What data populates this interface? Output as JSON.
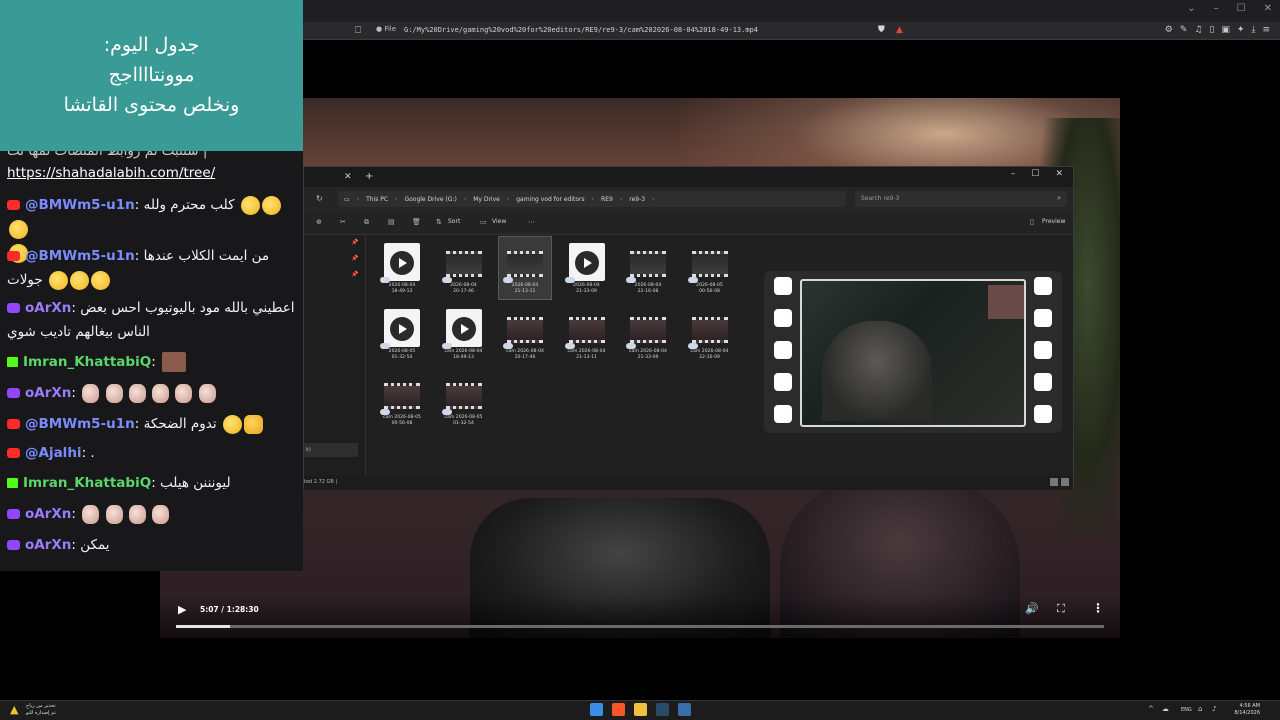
{
  "browser": {
    "window_controls": [
      "⌄",
      "–",
      "☐",
      "✕"
    ],
    "file_label": "File",
    "url": "G:/My%20Drive/gaming%20vod%20for%20editors/RE9/re9-3/cam%202026-08-04%2018-49-13.mp4"
  },
  "schedule": {
    "lines": [
      "جدول اليوم:",
      "موونتااااجج",
      "ونخلص محتوى القاتشا"
    ]
  },
  "chat": {
    "partial_top": "| ستتبت تم روابط المنصات تمها تت",
    "link": "https://shahadalabih.com/tree/",
    "messages": [
      {
        "platform": "youtube",
        "user": "@BMWm5-u1n",
        "text": "كلب محترم ولله"
      },
      {
        "platform": "youtube",
        "user": "@BMWm5-u1n",
        "text": "من ايمت الكلاب عندها",
        "text2": "جولات"
      },
      {
        "platform": "twitch",
        "user": "oArXn",
        "text": "اعطيني بالله مود باليوتيوب احس بعض",
        "text2": "الناس بيغالهم تاديب شوي"
      },
      {
        "platform": "kick",
        "user": "Imran_KhattabiQ",
        "text": ""
      },
      {
        "platform": "twitch",
        "user": "oArXn",
        "text": ""
      },
      {
        "platform": "youtube",
        "user": "@BMWm5-u1n",
        "text": "تدوم الضحكة"
      },
      {
        "platform": "youtube",
        "user": "@Ajalhi",
        "text": "."
      },
      {
        "platform": "kick",
        "user": "Imran_KhattabiQ",
        "text": "ليونننن هيلب"
      },
      {
        "platform": "twitch",
        "user": "oArXn",
        "text": ""
      },
      {
        "platform": "twitch",
        "user": "oArXn",
        "text": "يمكن"
      }
    ]
  },
  "explorer": {
    "breadcrumb": [
      "This PC",
      "Google Drive (G:)",
      "My Drive",
      "gaming vod for editors",
      "RE9",
      "re9-3"
    ],
    "search_placeholder": "Search re9-3",
    "sort_label": "Sort",
    "view_label": "View",
    "preview_label": "Preview",
    "nav_selected": "k)",
    "status": "ted  2.72 GB  |",
    "files": [
      {
        "kind": "video",
        "name1": "2026-08-04",
        "name2": "18-49-13"
      },
      {
        "kind": "clip",
        "name1": "2026-08-04",
        "name2": "20-17-46"
      },
      {
        "kind": "clip",
        "name1": "2026-08-04",
        "name2": "21-13-11",
        "selected": true
      },
      {
        "kind": "video",
        "name1": "2026-08-04",
        "name2": "21-33-09"
      },
      {
        "kind": "clip",
        "name1": "2026-08-04",
        "name2": "22-16-08"
      },
      {
        "kind": "clip",
        "name1": "2026-08-05",
        "name2": "00-56-08"
      },
      {
        "kind": "video",
        "name1": "2026-08-05",
        "name2": "01-32-54"
      },
      {
        "kind": "video",
        "name1": "cam 2026-08-04",
        "name2": "18-49-13"
      },
      {
        "kind": "face",
        "name1": "cam 2026-08-04",
        "name2": "20-17-46"
      },
      {
        "kind": "face",
        "name1": "cam 2026-08-04",
        "name2": "21-13-11"
      },
      {
        "kind": "face",
        "name1": "cam 2026-08-04",
        "name2": "21-33-09"
      },
      {
        "kind": "face",
        "name1": "cam 2026-08-04",
        "name2": "22-16-09"
      },
      {
        "kind": "face",
        "name1": "cam 2026-08-05",
        "name2": "00-56-08"
      },
      {
        "kind": "face",
        "name1": "cam 2026-08-05",
        "name2": "01-32-54"
      }
    ]
  },
  "player": {
    "time": "5:07 / 1:28:30",
    "progress_fraction": 0.058
  },
  "taskbar": {
    "weather_line1": "تحذير من رياح",
    "weather_line2": "تم إصداره للتو",
    "lang": "ENG",
    "time": "4:56 AM",
    "date": "8/14/2026"
  },
  "colors": {
    "schedule_bg": "#3a9a95",
    "chat_bg": "#18181b",
    "youtube": "#ff2a2a",
    "twitch": "#9146ff",
    "kick": "#53fc18"
  }
}
